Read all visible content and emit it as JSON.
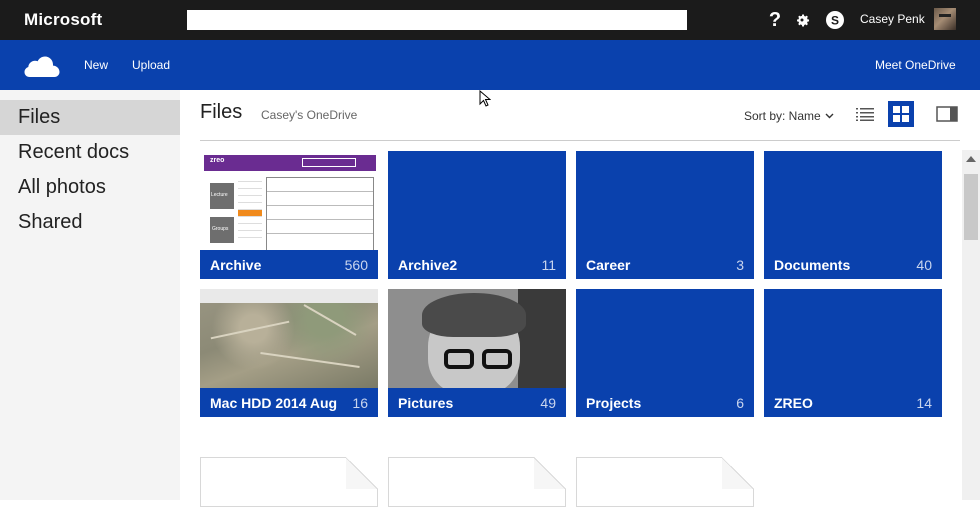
{
  "topbar": {
    "brand": "Microsoft",
    "search_value": "",
    "help_label": "?",
    "user_name": "Casey Penk"
  },
  "cmdbar": {
    "new_label": "New",
    "upload_label": "Upload",
    "meet_label": "Meet OneDrive"
  },
  "sidebar": {
    "items": [
      {
        "label": "Files",
        "active": true
      },
      {
        "label": "Recent docs"
      },
      {
        "label": "All photos"
      },
      {
        "label": "Shared"
      }
    ]
  },
  "header": {
    "title": "Files",
    "breadcrumb": "Casey's OneDrive",
    "sort_label": "Sort by: Name"
  },
  "tiles": [
    {
      "name": "Archive",
      "count": "560"
    },
    {
      "name": "Archive2",
      "count": "11"
    },
    {
      "name": "Career",
      "count": "3"
    },
    {
      "name": "Documents",
      "count": "40"
    },
    {
      "name": "Mac HDD 2014 Aug",
      "count": "16"
    },
    {
      "name": "Pictures",
      "count": "49"
    },
    {
      "name": "Projects",
      "count": "6"
    },
    {
      "name": "ZREO",
      "count": "14"
    }
  ],
  "archive_thumb": {
    "logo": "zreo",
    "button1": "Lecture",
    "button2": "Groups"
  },
  "colors": {
    "topbar": "#1b1b1b",
    "accent_blue": "#0a41ad",
    "nav_bg": "#f4f4f4",
    "nav_active": "#d6d6d6"
  }
}
